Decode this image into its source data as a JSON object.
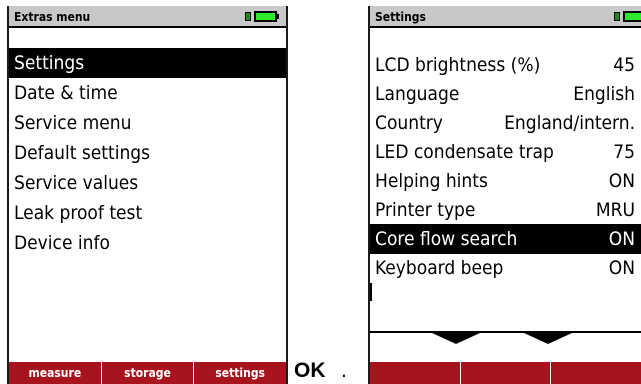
{
  "left_screen": {
    "title": "Extras menu",
    "items": [
      {
        "label": "Settings",
        "selected": true
      },
      {
        "label": "Date & time",
        "selected": false
      },
      {
        "label": "Service menu",
        "selected": false
      },
      {
        "label": "Default settings",
        "selected": false
      },
      {
        "label": "Service values",
        "selected": false
      },
      {
        "label": "Leak proof test",
        "selected": false
      },
      {
        "label": "Device info",
        "selected": false
      }
    ],
    "softkeys": [
      "measure",
      "storage",
      "settings"
    ]
  },
  "caption": {
    "ok": "OK",
    "punct": "."
  },
  "right_screen": {
    "title": "Settings",
    "items": [
      {
        "label": "LCD brightness (%)",
        "value": "45",
        "selected": false
      },
      {
        "label": "Language",
        "value": "English",
        "selected": false
      },
      {
        "label": "Country",
        "value": "England/intern.",
        "selected": false
      },
      {
        "label": "LED condensate trap",
        "value": "75",
        "selected": false
      },
      {
        "label": "Helping hints",
        "value": "ON",
        "selected": false
      },
      {
        "label": "Printer type",
        "value": "MRU",
        "selected": false
      },
      {
        "label": "Core flow search",
        "value": "ON",
        "selected": true
      },
      {
        "label": "Keyboard beep",
        "value": "ON",
        "selected": false
      }
    ]
  },
  "colors": {
    "softkey_bar": "#a8141e",
    "battery_fill": "#2ee82e",
    "title_bg": "#c8c8c8",
    "selection": "#000000"
  },
  "icons": [
    "battery-icon",
    "plug-icon",
    "scroll-down-arrow-icon"
  ]
}
